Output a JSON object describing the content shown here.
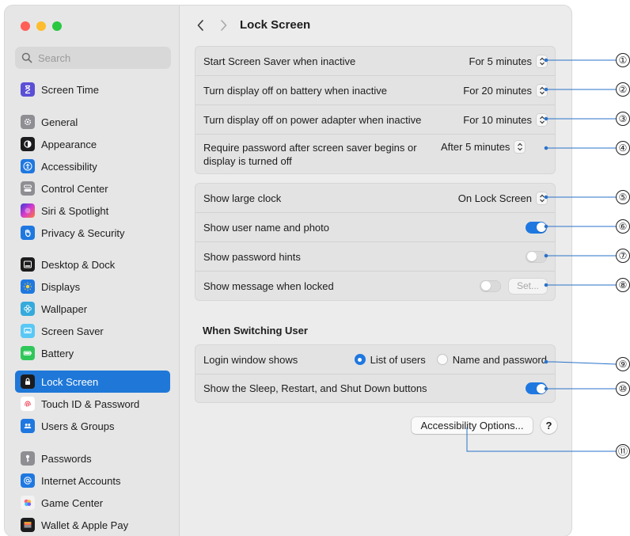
{
  "window": {
    "title": "Lock Screen",
    "search_placeholder": "Search"
  },
  "sidebar": {
    "items": [
      {
        "label": "Screen Time",
        "icon": "hourglass-icon",
        "color": "#5b4fd6"
      },
      {
        "label": "General",
        "icon": "gear-icon",
        "color": "#8e8e93"
      },
      {
        "label": "Appearance",
        "icon": "appearance-icon",
        "color": "#1c1c1e"
      },
      {
        "label": "Accessibility",
        "icon": "accessibility-icon",
        "color": "#1f78e0"
      },
      {
        "label": "Control Center",
        "icon": "control-center-icon",
        "color": "#8e8e93"
      },
      {
        "label": "Siri & Spotlight",
        "icon": "siri-icon",
        "color": "#c23adb"
      },
      {
        "label": "Privacy & Security",
        "icon": "hand-icon",
        "color": "#1f78e0"
      },
      {
        "label": "Desktop & Dock",
        "icon": "dock-icon",
        "color": "#1c1c1e"
      },
      {
        "label": "Displays",
        "icon": "sun-icon",
        "color": "#1f78e0"
      },
      {
        "label": "Wallpaper",
        "icon": "wallpaper-icon",
        "color": "#35aadc"
      },
      {
        "label": "Screen Saver",
        "icon": "screen-saver-icon",
        "color": "#5ac8f5"
      },
      {
        "label": "Battery",
        "icon": "battery-icon",
        "color": "#30c759"
      },
      {
        "label": "Lock Screen",
        "icon": "lock-icon",
        "color": "#1c1c1e"
      },
      {
        "label": "Touch ID & Password",
        "icon": "fingerprint-icon",
        "color": "#ffffff"
      },
      {
        "label": "Users & Groups",
        "icon": "users-icon",
        "color": "#1f78e0"
      },
      {
        "label": "Passwords",
        "icon": "key-icon",
        "color": "#8e8e93"
      },
      {
        "label": "Internet Accounts",
        "icon": "at-icon",
        "color": "#1f78e0"
      },
      {
        "label": "Game Center",
        "icon": "game-center-icon",
        "color": "#f2f2f2"
      },
      {
        "label": "Wallet & Apple Pay",
        "icon": "wallet-icon",
        "color": "#1c1c1e"
      }
    ],
    "active_label": "Lock Screen"
  },
  "group1": {
    "rows": [
      {
        "label": "Start Screen Saver when inactive",
        "value": "For 5 minutes"
      },
      {
        "label": "Turn display off on battery when inactive",
        "value": "For 20 minutes"
      },
      {
        "label": "Turn display off on power adapter when inactive",
        "value": "For 10 minutes"
      },
      {
        "label": "Require password after screen saver begins or display is turned off",
        "value": "After 5 minutes"
      }
    ]
  },
  "group2": {
    "large_clock_label": "Show large clock",
    "large_clock_value": "On Lock Screen",
    "user_name_label": "Show user name and photo",
    "user_name_on": true,
    "password_hints_label": "Show password hints",
    "password_hints_on": false,
    "message_label": "Show message when locked",
    "message_on": false,
    "set_button": "Set..."
  },
  "switching": {
    "heading": "When Switching User",
    "login_label": "Login window shows",
    "option_list": "List of users",
    "option_name": "Name and password",
    "selected": "List of users",
    "buttons_label": "Show the Sleep, Restart, and Shut Down buttons",
    "buttons_on": true
  },
  "footer": {
    "accessibility_button": "Accessibility Options...",
    "help_button": "?"
  },
  "callouts": [
    "①",
    "②",
    "③",
    "④",
    "⑤",
    "⑥",
    "⑦",
    "⑧",
    "⑨",
    "⑩",
    "⑪"
  ],
  "colors": {
    "accent": "#1f78e0",
    "sidebar_selection": "#1f78d8",
    "callout_line": "#2a72c9"
  }
}
